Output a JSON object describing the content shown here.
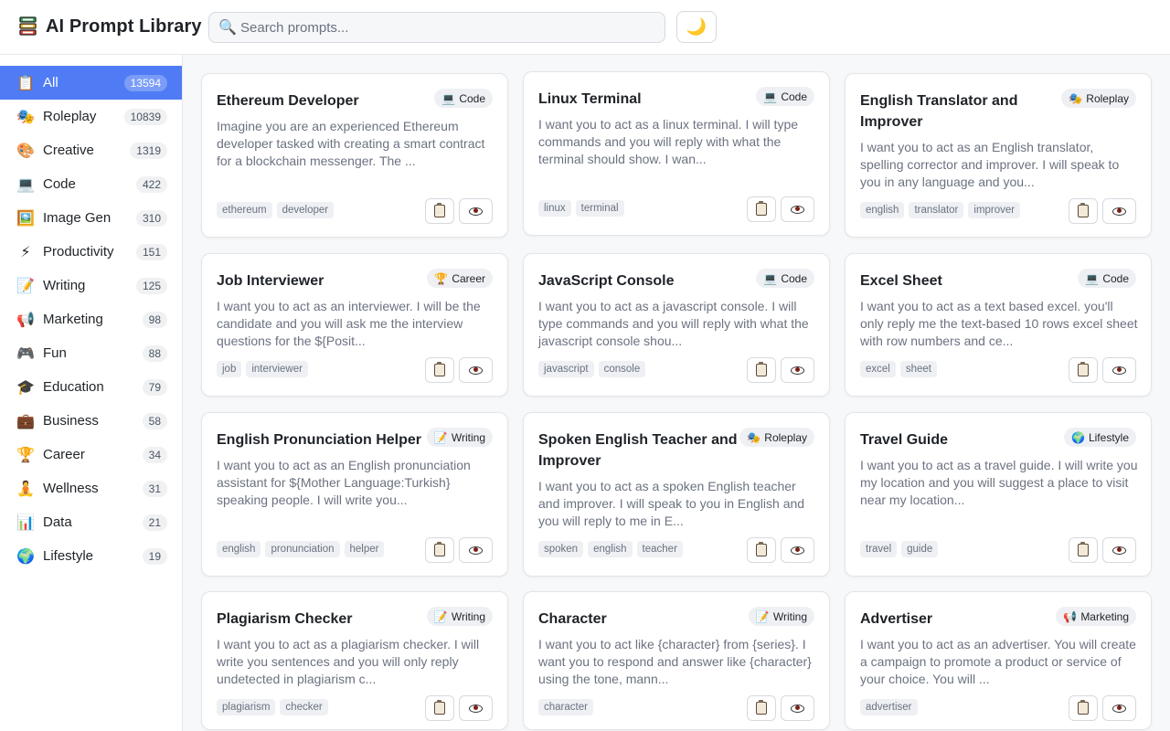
{
  "header": {
    "title": "AI Prompt Library",
    "search_placeholder": "Search prompts...",
    "search_value": "",
    "theme_toggle_icon": "🌙"
  },
  "sidebar": {
    "items": [
      {
        "label": "All",
        "count": "13594",
        "icon": "📋",
        "active": true
      },
      {
        "label": "Roleplay",
        "count": "10839",
        "icon": "🎭"
      },
      {
        "label": "Creative",
        "count": "1319",
        "icon": "🎨"
      },
      {
        "label": "Code",
        "count": "422",
        "icon": "💻"
      },
      {
        "label": "Image Gen",
        "count": "310",
        "icon": "🖼️"
      },
      {
        "label": "Productivity",
        "count": "151",
        "icon": "⚡"
      },
      {
        "label": "Writing",
        "count": "125",
        "icon": "📝"
      },
      {
        "label": "Marketing",
        "count": "98",
        "icon": "📢"
      },
      {
        "label": "Fun",
        "count": "88",
        "icon": "🎮"
      },
      {
        "label": "Education",
        "count": "79",
        "icon": "🎓"
      },
      {
        "label": "Business",
        "count": "58",
        "icon": "💼"
      },
      {
        "label": "Career",
        "count": "34",
        "icon": "🏆"
      },
      {
        "label": "Wellness",
        "count": "31",
        "icon": "🧘"
      },
      {
        "label": "Data",
        "count": "21",
        "icon": "📊"
      },
      {
        "label": "Lifestyle",
        "count": "19",
        "icon": "🌍"
      }
    ]
  },
  "cards": [
    {
      "title": "Ethereum Developer",
      "badge": "Code",
      "badge_icon": "💻",
      "desc": "Imagine you are an experienced Ethereum developer tasked with creating a smart contract for a blockchain messenger. The ...",
      "tags": [
        "ethereum",
        "developer"
      ]
    },
    {
      "title": "Linux Terminal",
      "badge": "Code",
      "badge_icon": "💻",
      "desc": "I want you to act as a linux terminal. I will type commands and you will reply with what the terminal should show. I wan...",
      "tags": [
        "linux",
        "terminal"
      ]
    },
    {
      "title": "English Translator and Improver",
      "badge": "Roleplay",
      "badge_icon": "🎭",
      "desc": "I want you to act as an English translator, spelling corrector and improver. I will speak to you in any language and you...",
      "tags": [
        "english",
        "translator",
        "improver"
      ]
    },
    {
      "title": "Job Interviewer",
      "badge": "Career",
      "badge_icon": "🏆",
      "desc": "I want you to act as an interviewer. I will be the candidate and you will ask me the interview questions for the ${Posit...",
      "tags": [
        "job",
        "interviewer"
      ]
    },
    {
      "title": "JavaScript Console",
      "badge": "Code",
      "badge_icon": "💻",
      "desc": "I want you to act as a javascript console. I will type commands and you will reply with what the javascript console shou...",
      "tags": [
        "javascript",
        "console"
      ]
    },
    {
      "title": "Excel Sheet",
      "badge": "Code",
      "badge_icon": "💻",
      "desc": "I want you to act as a text based excel. you'll only reply me the text-based 10 rows excel sheet with row numbers and ce...",
      "tags": [
        "excel",
        "sheet"
      ]
    },
    {
      "title": "English Pronunciation Helper",
      "badge": "Writing",
      "badge_icon": "📝",
      "desc": "I want you to act as an English pronunciation assistant for ${Mother Language:Turkish} speaking people. I will write you...",
      "tags": [
        "english",
        "pronunciation",
        "helper"
      ]
    },
    {
      "title": "Spoken English Teacher and Improver",
      "badge": "Roleplay",
      "badge_icon": "🎭",
      "desc": "I want you to act as a spoken English teacher and improver. I will speak to you in English and you will reply to me in E...",
      "tags": [
        "spoken",
        "english",
        "teacher"
      ]
    },
    {
      "title": "Travel Guide",
      "badge": "Lifestyle",
      "badge_icon": "🌍",
      "desc": "I want you to act as a travel guide. I will write you my location and you will suggest a place to visit near my location...",
      "tags": [
        "travel",
        "guide"
      ]
    },
    {
      "title": "Plagiarism Checker",
      "badge": "Writing",
      "badge_icon": "📝",
      "desc": "I want you to act as a plagiarism checker. I will write you sentences and you will only reply undetected in plagiarism c...",
      "tags": [
        "plagiarism",
        "checker"
      ]
    },
    {
      "title": "Character",
      "badge": "Writing",
      "badge_icon": "📝",
      "desc": "I want you to act like {character} from {series}. I want you to respond and answer like {character} using the tone, mann...",
      "tags": [
        "character"
      ]
    },
    {
      "title": "Advertiser",
      "badge": "Marketing",
      "badge_icon": "📢",
      "desc": "I want you to act as an advertiser. You will create a campaign to promote a product or service of your choice. You will ...",
      "tags": [
        "advertiser"
      ]
    }
  ]
}
